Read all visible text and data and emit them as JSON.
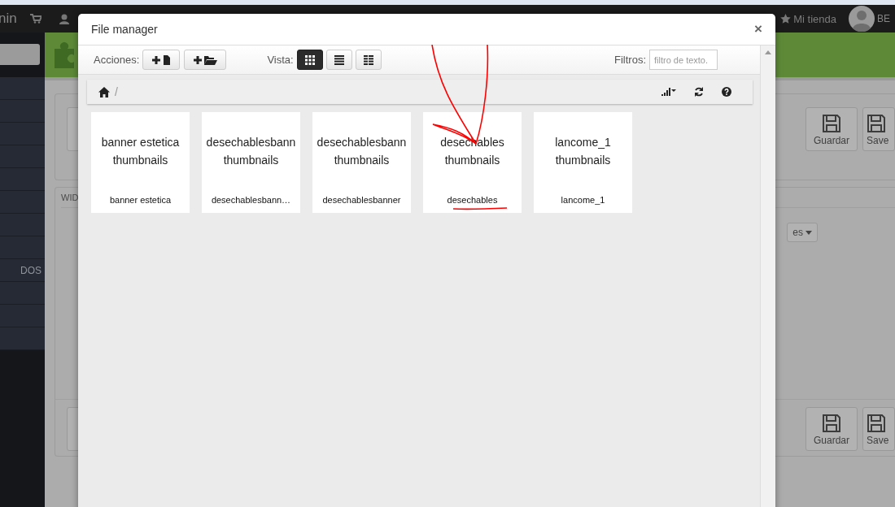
{
  "topbar": {
    "brand": "nin",
    "store_link": "Mi tienda",
    "user_name": "BE"
  },
  "sidebar": {
    "item_label": "DOS"
  },
  "form": {
    "top_actions": [
      {
        "kind": "plain"
      },
      {
        "kind": "save",
        "label": "Guardar"
      },
      {
        "kind": "save-and",
        "label": "Save"
      }
    ],
    "widget_title": "WID",
    "language": "es",
    "bottom_actions": [
      {
        "kind": "plain"
      },
      {
        "kind": "save",
        "label": "Guardar"
      },
      {
        "kind": "save-and",
        "label": "Save"
      }
    ]
  },
  "file_manager": {
    "title": "File manager",
    "close": "×",
    "actions_label": "Acciones:",
    "actions": [
      {
        "kind": "new-file"
      },
      {
        "kind": "new-folder"
      }
    ],
    "view_label": "Vista:",
    "views": [
      {
        "kind": "grid",
        "selected": true
      },
      {
        "kind": "list",
        "selected": false
      },
      {
        "kind": "columns",
        "selected": false
      }
    ],
    "filter_label": "Filtros:",
    "filter": {
      "placeholder": "filtro de texto."
    },
    "breadcrumb": {
      "separator": "/"
    },
    "folders": [
      {
        "thumb_lines": [
          "banner estetica",
          "thumbnails"
        ],
        "caption": "banner estetica"
      },
      {
        "thumb_lines": [
          "desechablesbann",
          "thumbnails"
        ],
        "caption": "desechablesbann…"
      },
      {
        "thumb_lines": [
          "desechablesbann",
          "thumbnails"
        ],
        "caption": "desechablesbanner"
      },
      {
        "thumb_lines": [
          "desechables",
          "thumbnails"
        ],
        "caption": "desechables"
      },
      {
        "thumb_lines": [
          "lancome_1",
          "thumbnails"
        ],
        "caption": "lancome_1"
      }
    ]
  }
}
